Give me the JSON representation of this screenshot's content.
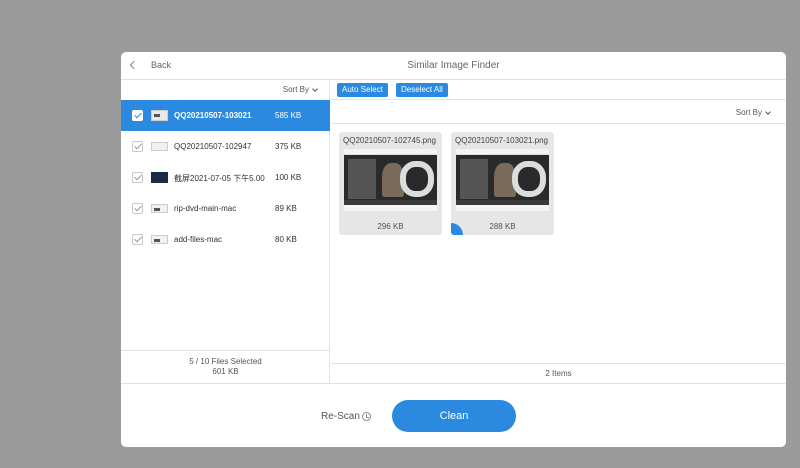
{
  "window": {
    "title": "Similar Image Finder",
    "back_label": "Back"
  },
  "left_panel": {
    "sort_label": "Sort By",
    "files": [
      {
        "name": "QQ20210507-103021",
        "size": "585 KB",
        "selected": true,
        "checked": true,
        "thumb": "light"
      },
      {
        "name": "QQ20210507-102947",
        "size": "375 KB",
        "selected": false,
        "checked": true,
        "thumb": "light"
      },
      {
        "name": "截屏2021-07-05 下午5.00",
        "size": "100 KB",
        "selected": false,
        "checked": true,
        "thumb": "dark"
      },
      {
        "name": "rip-dvd-main-mac",
        "size": "89 KB",
        "selected": false,
        "checked": true,
        "thumb": "small"
      },
      {
        "name": "add-files-mac",
        "size": "80 KB",
        "selected": false,
        "checked": true,
        "thumb": "small"
      }
    ],
    "footer": {
      "selected_text": "5 / 10 Files Selected",
      "total_size": "601 KB"
    }
  },
  "right_panel": {
    "auto_select_label": "Auto Select",
    "deselect_all_label": "Deselect All",
    "sort_label": "Sort By",
    "images": [
      {
        "name": "QQ20210507-102745.png",
        "size": "296 KB",
        "selected": false
      },
      {
        "name": "QQ20210507-103021.png",
        "size": "288 KB",
        "selected": true
      }
    ],
    "item_count": "2 Items"
  },
  "bottom": {
    "rescan_label": "Re-Scan",
    "clean_label": "Clean"
  },
  "colors": {
    "accent": "#2b8ae0",
    "backdrop": "#9b9b9b"
  }
}
